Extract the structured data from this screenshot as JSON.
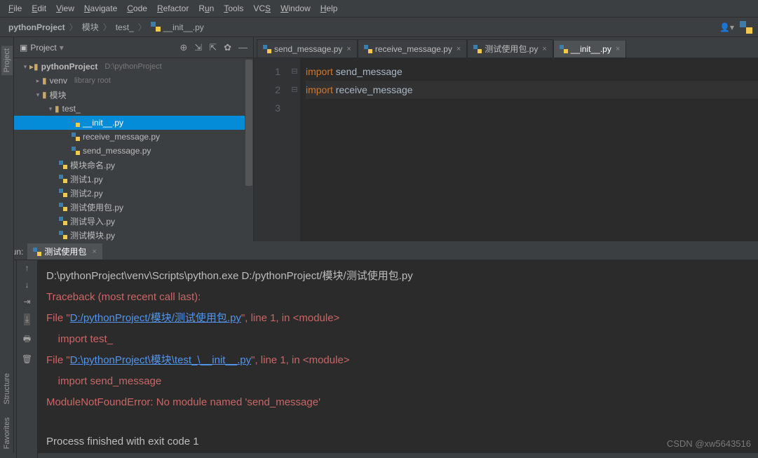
{
  "menu": [
    "File",
    "Edit",
    "View",
    "Navigate",
    "Code",
    "Refactor",
    "Run",
    "Tools",
    "VCS",
    "Window",
    "Help"
  ],
  "breadcrumb": {
    "root": "pythonProject",
    "mid": "模块",
    "sub": "test_",
    "file": "__init__.py"
  },
  "project_panel": {
    "title": "Project"
  },
  "tree": {
    "root": "pythonProject",
    "rootPath": "D:\\pythonProject",
    "venv": "venv",
    "venvHint": "library root",
    "mod": "模块",
    "test": "test_",
    "files_test": [
      "__init__.py",
      "receive_message.py",
      "send_message.py"
    ],
    "files_mod": [
      "模块命名.py",
      "测试1.py",
      "测试2.py",
      "测试使用包.py",
      "测试导入.py",
      "测试模块.py"
    ]
  },
  "tabs": [
    {
      "label": "send_message.py",
      "active": false
    },
    {
      "label": "receive_message.py",
      "active": false
    },
    {
      "label": "测试使用包.py",
      "active": false
    },
    {
      "label": "__init__.py",
      "active": true
    }
  ],
  "editor": {
    "lines": [
      {
        "n": "1",
        "kw": "import",
        "id": "send_message"
      },
      {
        "n": "2",
        "kw": "import",
        "id": "receive_message"
      },
      {
        "n": "3",
        "kw": "",
        "id": ""
      }
    ]
  },
  "run": {
    "title": "Run:",
    "tab": "测试使用包",
    "cmd": "D:\\pythonProject\\venv\\Scripts\\python.exe D:/pythonProject/模块/测试使用包.py",
    "tb": "Traceback (most recent call last):",
    "f1a": "  File \"",
    "f1link": "D:/pythonProject/模块/测试使用包.py",
    "f1b": "\", line 1, in <module>",
    "imp1": "    import test_",
    "f2a": "  File \"",
    "f2link": "D:\\pythonProject\\模块\\test_\\__init__.py",
    "f2b": "\", line 1, in <module>",
    "imp2": "    import send_message",
    "err": "ModuleNotFoundError: No module named 'send_message'",
    "exit": "Process finished with exit code 1"
  },
  "watermark": "CSDN @xw5643516",
  "side": {
    "project": "Project",
    "structure": "Structure",
    "favorites": "Favorites"
  }
}
